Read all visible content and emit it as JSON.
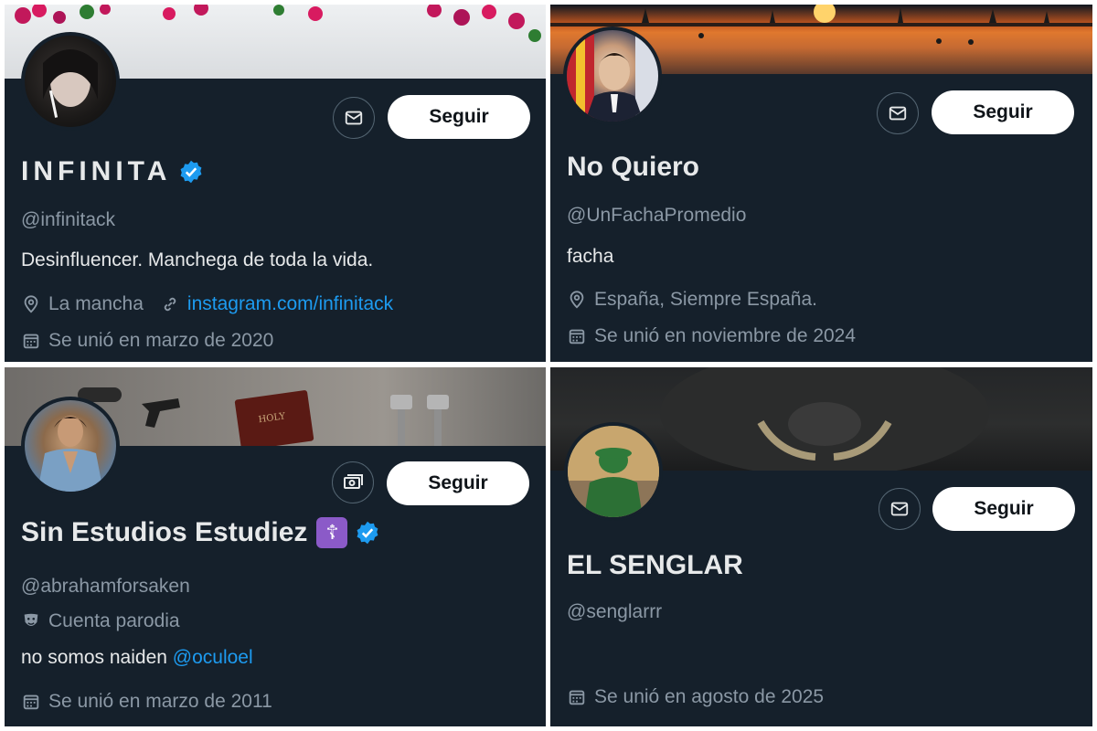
{
  "profiles": [
    {
      "name": "INFINITA",
      "verified": true,
      "handle": "@infinitack",
      "bio": "Desinfluencer. Manchega de toda la vida.",
      "location": "La mancha",
      "link": "instagram.com/infinitack",
      "joined": "Se unió en marzo de 2020",
      "follow_label": "Seguir",
      "message_icon": "envelope-icon"
    },
    {
      "name": "No Quiero",
      "verified": false,
      "handle": "@UnFachaPromedio",
      "bio": "facha",
      "location": "España, Siempre España.",
      "joined": "Se unió en noviembre de 2024",
      "follow_label": "Seguir",
      "message_icon": "envelope-icon"
    },
    {
      "name": "Sin Estudios Estudiez",
      "name_emoji": "☦",
      "verified": true,
      "handle": "@abrahamforsaken",
      "account_label": "Cuenta parodia",
      "bio_text": "no somos naiden ",
      "bio_mention": "@oculoel",
      "joined": "Se unió en marzo de 2011",
      "follow_label": "Seguir",
      "message_icon": "money-icon"
    },
    {
      "name": "EL SENGLAR",
      "verified": false,
      "handle": "@senglarrr",
      "joined": "Se unió en agosto de 2025",
      "follow_label": "Seguir",
      "message_icon": "envelope-icon"
    }
  ],
  "colors": {
    "background": "#15202b",
    "text": "#e7e9ea",
    "muted": "#8b98a5",
    "link": "#1d9bf0",
    "verified": "#1d9bf0"
  }
}
